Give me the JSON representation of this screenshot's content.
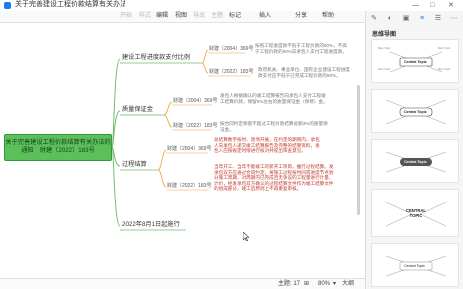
{
  "window": {
    "doc_title": "关于完善建设工程价款结算有关办法",
    "controls": [
      "—",
      "□",
      "✕"
    ]
  },
  "menubar": {
    "items": [
      {
        "label": "开始",
        "dim": true
      },
      {
        "label": "样式",
        "dim": true
      },
      {
        "label": "编辑",
        "dim": false
      },
      {
        "label": "视图",
        "dim": false
      },
      {
        "label": "导出",
        "dim": true
      },
      {
        "label": "主题",
        "dim": true
      },
      {
        "label": "标记",
        "dim": false
      },
      {
        "label": "插入",
        "dim": false
      },
      {
        "label": "分享",
        "dim": false
      },
      {
        "label": "帮助",
        "dim": false
      }
    ]
  },
  "right_panel": {
    "section_title": "思维导图",
    "icons": [
      "style-icon",
      "theme-icon",
      "image-icon",
      "list-icon",
      "outline-icon",
      "more-icon"
    ],
    "templates": [
      {
        "label": "Central Topic"
      },
      {
        "label": "Central Topic"
      },
      {
        "label": "Central Topic"
      },
      {
        "label": "CENTRAL TOPIC"
      },
      {
        "label": "Central Topic"
      }
    ],
    "mini_labels": [
      "Main Topic",
      "Main Topic",
      "Main Topic",
      "Main Topic"
    ]
  },
  "map": {
    "central": "关于完善建设工程价款结算有关办法的通知　财建〔2022〕183号",
    "branches": [
      {
        "label": "建设工程进度款支付比例",
        "subs": [
          {
            "label": "财建〔2004〕369号",
            "leaf": "按照工程进度款不低于工程价款的60%，不高于工程价款的90%向承包人支付工程进度款。"
          },
          {
            "label": "财建〔2022〕183号",
            "leaf": "政府机关、事业单位、国有企业建设工程进度款支付应不低于已完成工程价款的80%。"
          }
        ]
      },
      {
        "label": "质量保证金",
        "subs": [
          {
            "label": "财建〔2004〕369号",
            "leaf": "发包人根据确认的竣工结算报告向承包人支付工程竣工结算价款，保留5%左右的质量保证金（保修）金。"
          },
          {
            "label": "财建〔2022〕183号",
            "leaf": "按合同约定保留不超过工程价款结算总额3%的质量保证金。"
          }
        ]
      },
      {
        "label": "过程结算",
        "subs": [
          {
            "label": "财建〔2004〕369号",
            "leaf": "总结算数字按时、逐项开展，在约定的期限内，承包人向发包人递交竣工结算报告及完整的结算资料，发包人应按规定时限进行核对并提出审查意见。"
          },
          {
            "label": "财建〔2022〕183号",
            "leaf": "当年开工、当年不能竣工的新开工项目，推行过程结算。发承包双方应通过合同约定，将施工过程按时间或进度节点划分施工周期，对周期内已完成且无争议的工程量进行计量、计价，经发承包双方确认的过程结算文件作为竣工结算文件的组成部分，竣工后原则上不再重复审核。"
          }
        ]
      },
      {
        "label": "2022年8月1日起施行",
        "subs": []
      }
    ]
  },
  "statusbar": {
    "topic_count_label": "主题: 17",
    "zoom": "80%",
    "full_label": "大纲"
  }
}
